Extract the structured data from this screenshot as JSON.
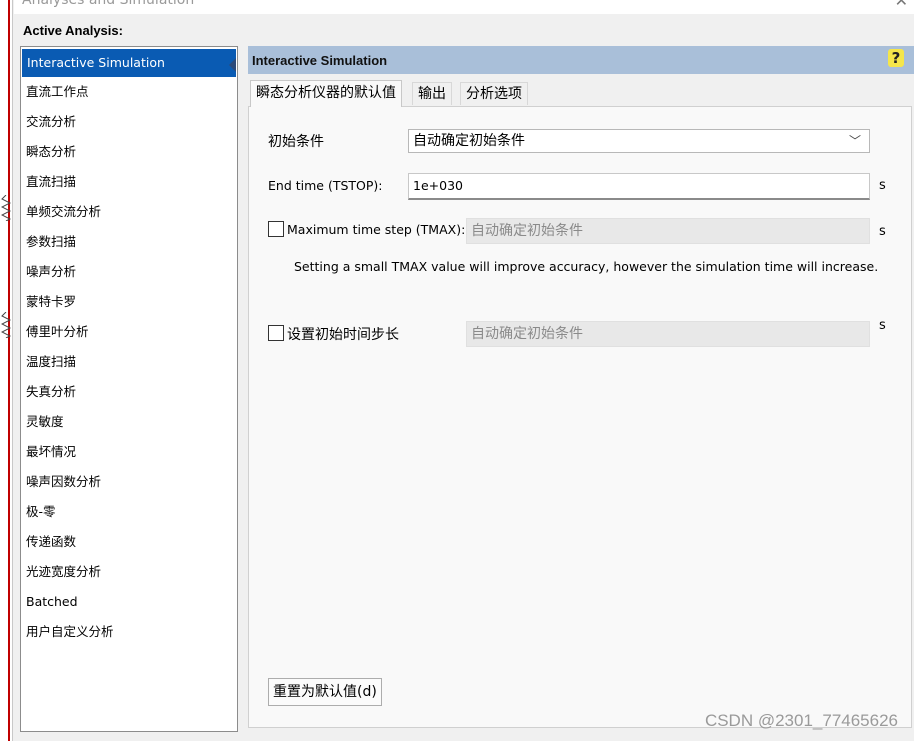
{
  "window": {
    "title": "Analyses and Simulation"
  },
  "active_analysis_label": "Active Analysis:",
  "analysis_list": [
    "Interactive Simulation",
    "直流工作点",
    "交流分析",
    "瞬态分析",
    "直流扫描",
    "单频交流分析",
    "参数扫描",
    "噪声分析",
    "蒙特卡罗",
    "傅里叶分析",
    "温度扫描",
    "失真分析",
    "灵敏度",
    "最坏情况",
    "噪声因数分析",
    "极-零",
    "传递函数",
    "光迹宽度分析",
    "Batched",
    "用户自定义分析"
  ],
  "panel": {
    "title": "Interactive Simulation",
    "help_glyph": "?",
    "tabs": [
      "瞬态分析仪器的默认值",
      "输出",
      "分析选项"
    ]
  },
  "form": {
    "initial_conditions_label": "初始条件",
    "initial_conditions_value": "自动确定初始条件",
    "end_time_label": "End time (TSTOP):",
    "end_time_value": "1e+030",
    "end_time_unit": "s",
    "tmax_label": "Maximum time step (TMAX):",
    "tmax_value": "自动确定初始条件",
    "tmax_unit": "s",
    "tmax_checked": false,
    "note": "Setting a small TMAX value will improve accuracy, however the simulation time will increase.",
    "initial_step_label": "设置初始时间步长",
    "initial_step_value": "自动确定初始条件",
    "initial_step_unit": "s",
    "initial_step_checked": false
  },
  "reset_button": "重置为默认值(d)",
  "watermark": "CSDN @2301_77465626",
  "colors": {
    "selection": "#0a5bb3",
    "panel_header": "#a9bfd9",
    "help_icon": "#f5e64a"
  }
}
